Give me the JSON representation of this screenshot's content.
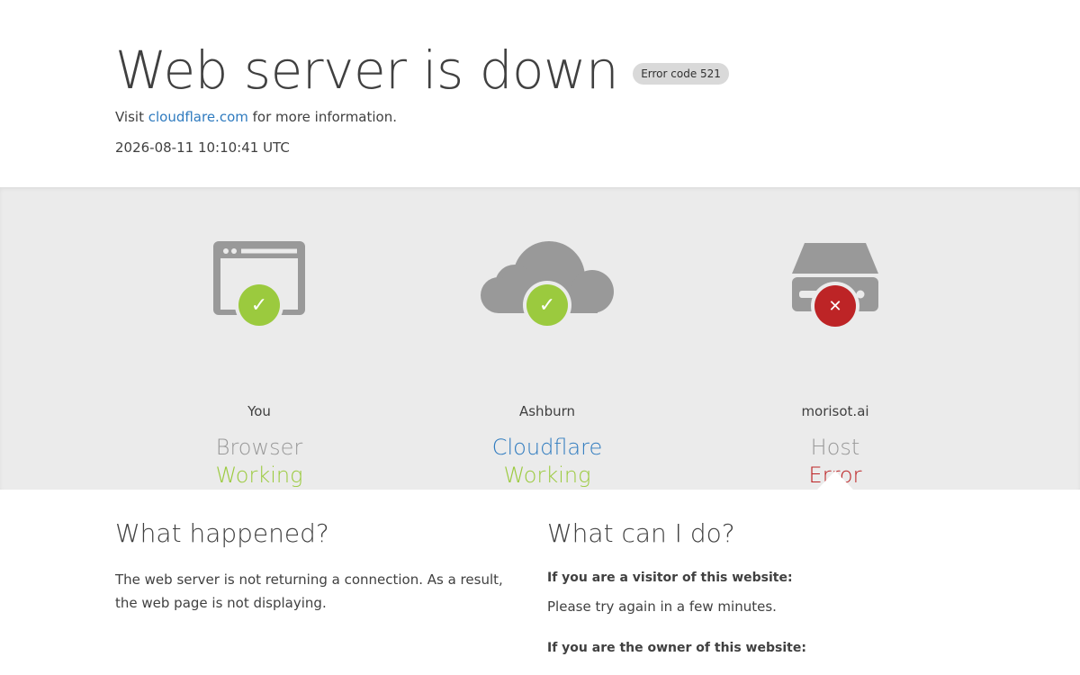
{
  "header": {
    "title": "Web server is down",
    "error_code": "Error code 521",
    "visit_prefix": "Visit ",
    "visit_link": "cloudflare.com",
    "visit_suffix": " for more information.",
    "timestamp": "2026-08-11 10:10:41 UTC"
  },
  "nodes": [
    {
      "location": "You",
      "role": "Browser",
      "status": "Working",
      "icon": "browser-icon",
      "state": "ok"
    },
    {
      "location": "Ashburn",
      "role": "Cloudflare",
      "status": "Working",
      "icon": "cloud-icon",
      "state": "ok"
    },
    {
      "location": "morisot.ai",
      "role": "Host",
      "status": "Error",
      "icon": "server-icon",
      "state": "error"
    }
  ],
  "what_happened": {
    "heading": "What happened?",
    "body": "The web server is not returning a connection. As a result, the web page is not displaying."
  },
  "what_can_i_do": {
    "heading": "What can I do?",
    "visitor_q": "If you are a visitor of this website:",
    "visitor_a": "Please try again in a few minutes.",
    "owner_q": "If you are the owner of this website:"
  },
  "colors": {
    "working": "#9bca3e",
    "error": "#bd2426",
    "link": "#2f7bbf",
    "band": "#ebebeb"
  }
}
